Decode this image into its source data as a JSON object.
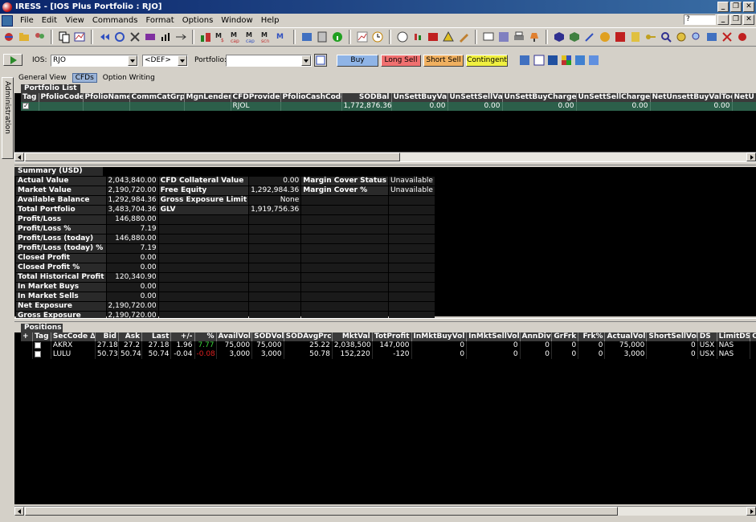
{
  "window": {
    "title": "IRESS - [IOS Plus Portfolio : RJO]"
  },
  "menu": [
    "File",
    "Edit",
    "View",
    "Commands",
    "Format",
    "Options",
    "Window",
    "Help"
  ],
  "help_box": "?",
  "order_bar": {
    "ios_label": "IOS:",
    "ios_value": "RJO",
    "def_value": "<DEF>",
    "portfolio_label": "Portfolio:",
    "portfolio_value": "",
    "buttons": [
      {
        "label": "Buy",
        "color": "#8fb4e6"
      },
      {
        "label": "Long Sell",
        "color": "#f07070"
      },
      {
        "label": "Short Sell",
        "color": "#f0b060"
      },
      {
        "label": "Contingent",
        "color": "#f0f040"
      }
    ]
  },
  "sidebar": {
    "admin_label": "Administration"
  },
  "tabs": [
    {
      "label": "General View",
      "active": false
    },
    {
      "label": "CFDs",
      "active": true
    },
    {
      "label": "Option Writing",
      "active": false
    }
  ],
  "portfolio_list": {
    "title": "Portfolio List",
    "columns": [
      "Tag",
      "PfolioCode",
      "PfolioName",
      "CommCatGrp",
      "MgnLender",
      "CFDProvider",
      "PfolioCashCode",
      "SODBal",
      "UnSettBuyVal",
      "UnSettSellVal",
      "UnSettBuyCharges",
      "UnSettSellCharges",
      "NetUnsettBuyValTod",
      "NetU"
    ],
    "rows": [
      [
        "",
        "",
        "",
        "",
        "",
        "RJOL",
        "",
        "1,772,876.36",
        "0.00",
        "0.00",
        "0.00",
        "0.00",
        "0.00",
        ""
      ]
    ]
  },
  "summary": {
    "title": "Summary (USD)",
    "col1": [
      {
        "k": "Actual Value",
        "v": "2,043,840.00"
      },
      {
        "k": "Market Value",
        "v": "2,190,720.00"
      },
      {
        "k": "Available Balance",
        "v": "1,292,984.36"
      },
      {
        "k": "Total Portfolio",
        "v": "3,483,704.36"
      },
      {
        "k": "Profit/Loss",
        "v": "146,880.00"
      },
      {
        "k": "Profit/Loss %",
        "v": "7.19"
      },
      {
        "k": "Profit/Loss (today)",
        "v": "146,880.00"
      },
      {
        "k": "Profit/Loss (today) %",
        "v": "7.19"
      },
      {
        "k": "Closed Profit",
        "v": "0.00"
      },
      {
        "k": "Closed Profit %",
        "v": "0.00"
      },
      {
        "k": "Total Historical Profit",
        "v": "120,340.90"
      },
      {
        "k": "In Market Buys",
        "v": "0.00"
      },
      {
        "k": "In Market Sells",
        "v": "0.00"
      },
      {
        "k": "Net Exposure",
        "v": "2,190,720.00"
      },
      {
        "k": "Gross Exposure",
        "v": "2,190,720.00"
      }
    ],
    "col2": [
      {
        "k": "CFD Collateral Value",
        "v": "0.00"
      },
      {
        "k": "Free Equity",
        "v": "1,292,984.36"
      },
      {
        "k": "Gross Exposure Limit",
        "v": "None"
      },
      {
        "k": "GLV",
        "v": "1,919,756.36"
      }
    ],
    "col3": [
      {
        "k": "Margin Cover Status",
        "v": "Unavailable"
      },
      {
        "k": "Margin Cover %",
        "v": "Unavailable"
      }
    ]
  },
  "positions": {
    "title": "Positions",
    "columns": [
      "+",
      "Tag",
      "SecCode ∆",
      "Bid",
      "Ask",
      "Last",
      "+/-",
      "%",
      "AvailVol",
      "SODVol",
      "SODAvgPrc",
      "MktVal",
      "TotProfit",
      "InMktBuyVol",
      "InMktSellVol",
      "AnnDiv",
      "GrFrk",
      "Frk%",
      "ActualVol",
      "ShortSellVol",
      "DS",
      "LimitDS",
      "Op"
    ],
    "rows": [
      [
        "",
        "",
        "AKRX",
        "27.18",
        "27.2",
        "27.18",
        "1.96",
        "7.77",
        "75,000",
        "75,000",
        "25.22",
        "2,038,500",
        "147,000",
        "0",
        "0",
        "0",
        "0",
        "0",
        "75,000",
        "0",
        "USX",
        "NAS",
        ""
      ],
      [
        "",
        "",
        "LULU",
        "50.73",
        "50.74",
        "50.74",
        "-0.04",
        "-0.08",
        "3,000",
        "3,000",
        "50.78",
        "152,220",
        "-120",
        "0",
        "0",
        "0",
        "0",
        "0",
        "3,000",
        "0",
        "USX",
        "NAS",
        ""
      ]
    ],
    "pct_colors": [
      "#3cd63c",
      "#e02020"
    ]
  }
}
